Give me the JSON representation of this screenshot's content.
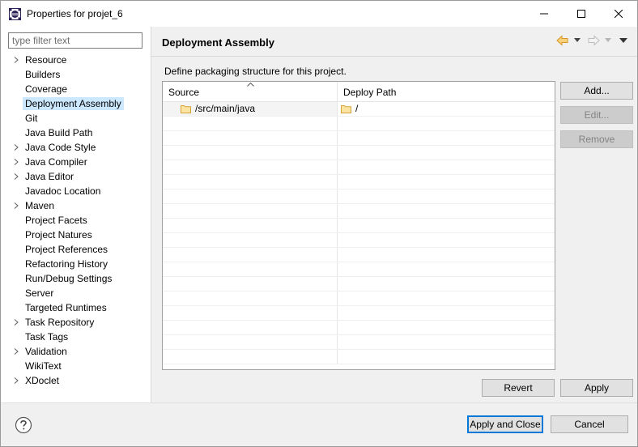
{
  "window": {
    "title": "Properties for projet_6",
    "controls": {
      "minimize": "minimize-icon",
      "maximize": "maximize-icon",
      "close": "close-icon"
    }
  },
  "filter": {
    "placeholder": "type filter text",
    "value": ""
  },
  "nav": {
    "items": [
      {
        "label": "Resource",
        "expandable": true
      },
      {
        "label": "Builders",
        "expandable": false
      },
      {
        "label": "Coverage",
        "expandable": false
      },
      {
        "label": "Deployment Assembly",
        "expandable": false,
        "selected": true
      },
      {
        "label": "Git",
        "expandable": false
      },
      {
        "label": "Java Build Path",
        "expandable": false
      },
      {
        "label": "Java Code Style",
        "expandable": true
      },
      {
        "label": "Java Compiler",
        "expandable": true
      },
      {
        "label": "Java Editor",
        "expandable": true
      },
      {
        "label": "Javadoc Location",
        "expandable": false
      },
      {
        "label": "Maven",
        "expandable": true
      },
      {
        "label": "Project Facets",
        "expandable": false
      },
      {
        "label": "Project Natures",
        "expandable": false
      },
      {
        "label": "Project References",
        "expandable": false
      },
      {
        "label": "Refactoring History",
        "expandable": false
      },
      {
        "label": "Run/Debug Settings",
        "expandable": false
      },
      {
        "label": "Server",
        "expandable": false
      },
      {
        "label": "Targeted Runtimes",
        "expandable": false
      },
      {
        "label": "Task Repository",
        "expandable": true
      },
      {
        "label": "Task Tags",
        "expandable": false
      },
      {
        "label": "Validation",
        "expandable": true
      },
      {
        "label": "WikiText",
        "expandable": false
      },
      {
        "label": "XDoclet",
        "expandable": true
      }
    ]
  },
  "page": {
    "title": "Deployment Assembly",
    "description": "Define packaging structure for this project.",
    "table": {
      "columns": [
        "Source",
        "Deploy Path"
      ],
      "rows": [
        {
          "source": "/src/main/java",
          "deploy_path": "/"
        }
      ]
    },
    "side_buttons": {
      "add": "Add...",
      "edit": "Edit...",
      "remove": "Remove"
    },
    "revert": "Revert",
    "apply": "Apply"
  },
  "footer": {
    "apply_close": "Apply and Close",
    "cancel": "Cancel",
    "help_icon": "help-icon"
  },
  "colors": {
    "selection": "#cce8ff",
    "panel": "#f0f0f0",
    "default_button_border": "#0078d7",
    "folder_icon": "#e8b64c",
    "back_arrow": "#e8a33a"
  }
}
